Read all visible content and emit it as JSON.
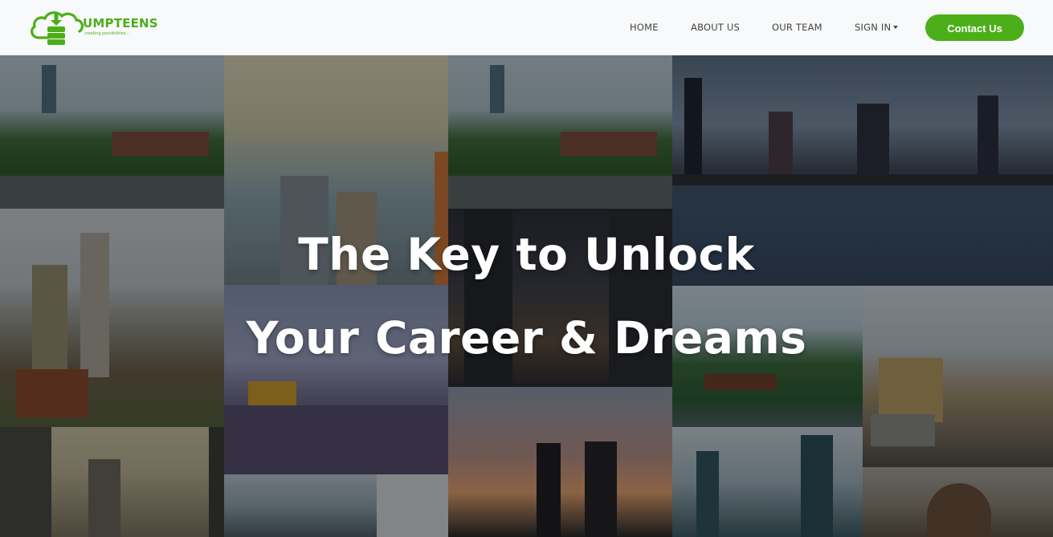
{
  "brand": {
    "name": "UMPTEENS",
    "tagline": "creating possibilities...",
    "color": "#4caf1a"
  },
  "nav": {
    "items": [
      {
        "label": "HOME"
      },
      {
        "label": "ABOUT US"
      },
      {
        "label": "OUR TEAM"
      },
      {
        "label": "SIGN IN",
        "icon": "caret-down-icon"
      }
    ],
    "cta": "Contact Us"
  },
  "hero": {
    "line1": "The Key to Unlock",
    "line2": "Your Career & Dreams",
    "background": "collage of city skyline photographs"
  }
}
